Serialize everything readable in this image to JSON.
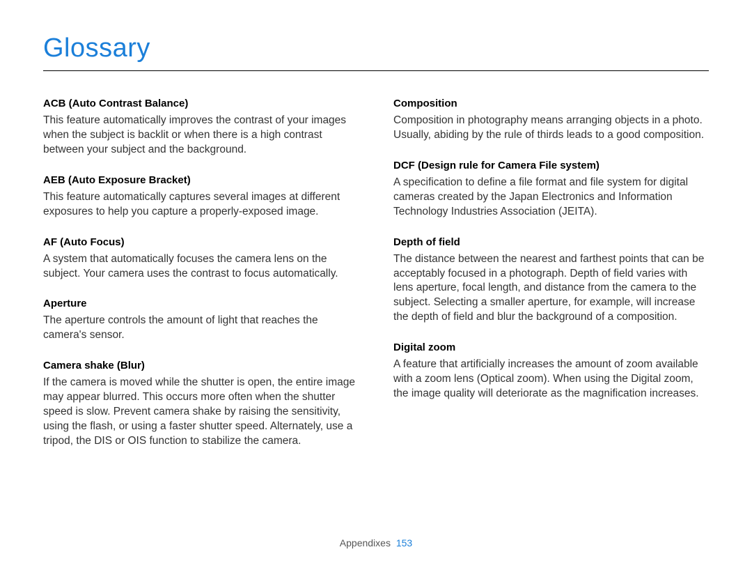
{
  "title": "Glossary",
  "footer": {
    "section": "Appendixes",
    "page": "153"
  },
  "left": [
    {
      "term": "ACB (Auto Contrast Balance)",
      "def": "This feature automatically improves the contrast of your images when the subject is backlit or when there is a high contrast between your subject and the background."
    },
    {
      "term": "AEB (Auto Exposure Bracket)",
      "def": "This feature automatically captures several images at different exposures to help you capture a properly-exposed image."
    },
    {
      "term": "AF (Auto Focus)",
      "def": "A system that automatically focuses the camera lens on the subject. Your camera uses the contrast to focus automatically."
    },
    {
      "term": "Aperture",
      "def": "The aperture controls the amount of light that reaches the camera's sensor."
    },
    {
      "term": "Camera shake (Blur)",
      "def": "If the camera is moved while the shutter is open, the entire image may appear blurred. This occurs more often when the shutter speed is slow. Prevent camera shake by raising the sensitivity, using the flash, or using a faster shutter speed. Alternately, use a tripod, the DIS or OIS function to stabilize the camera."
    }
  ],
  "right": [
    {
      "term": "Composition",
      "def": "Composition in photography means arranging objects in a photo. Usually, abiding by the rule of thirds leads to a good composition."
    },
    {
      "term": "DCF (Design rule for Camera File system)",
      "def": "A specification to define a file format and file system for digital cameras created by the Japan Electronics and Information Technology Industries Association (JEITA)."
    },
    {
      "term": "Depth of field",
      "def": "The distance between the nearest and farthest points that can be acceptably focused in a photograph. Depth of field varies with lens aperture, focal length, and distance from the camera to the subject. Selecting a smaller aperture, for example, will increase the depth of field and blur the background of a composition."
    },
    {
      "term": "Digital zoom",
      "def": "A feature that artificially increases the amount of zoom available with a zoom lens (Optical zoom). When using the Digital zoom, the image quality will deteriorate as the magnification increases."
    }
  ]
}
